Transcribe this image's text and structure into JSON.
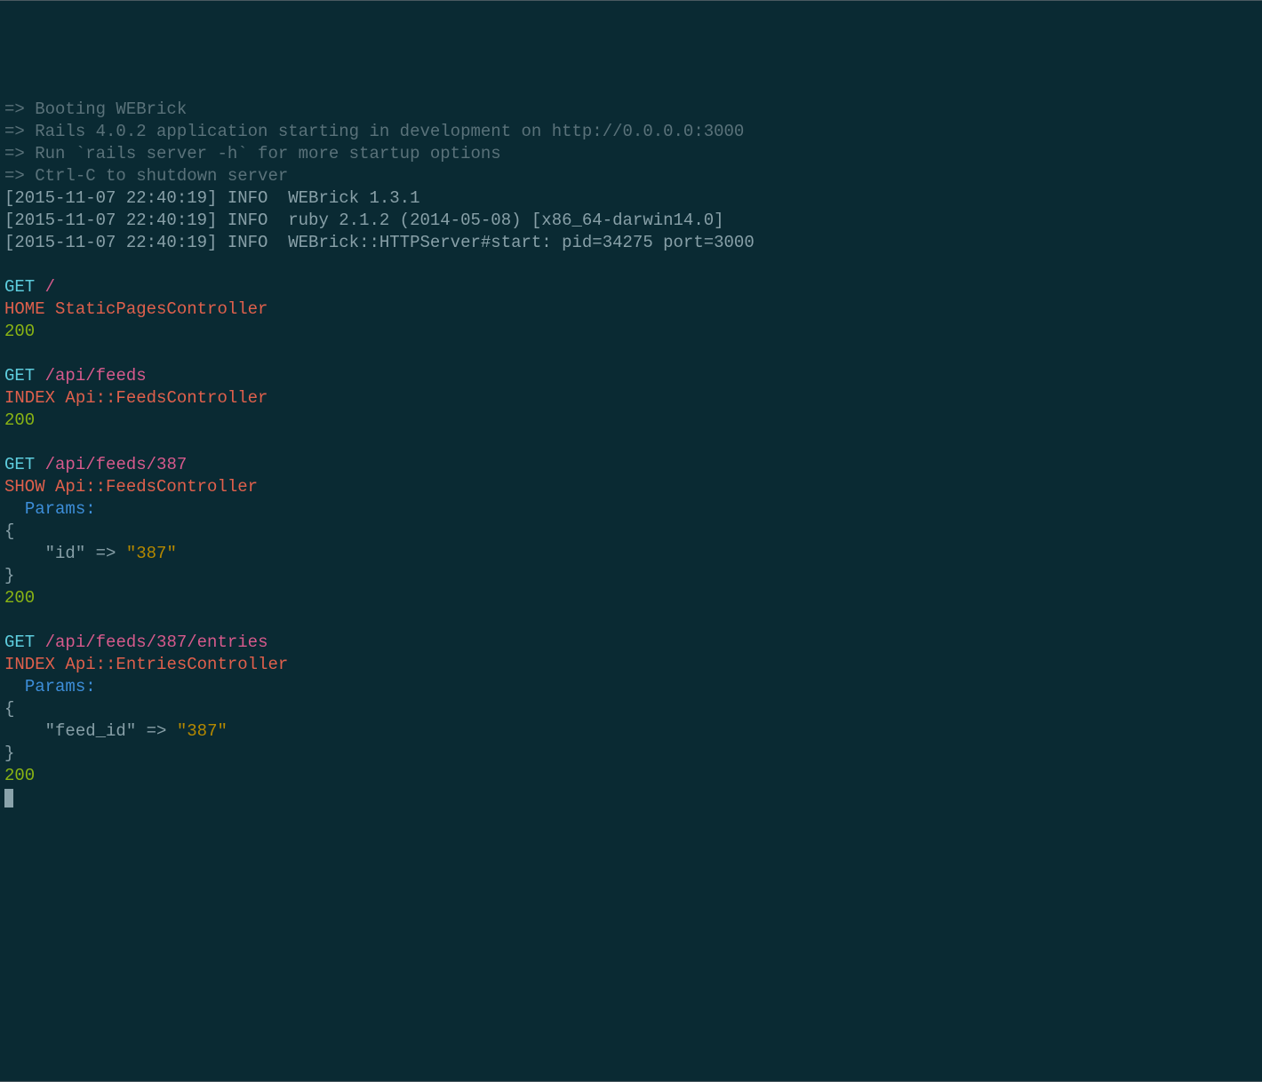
{
  "boot": {
    "l1": "=> Booting WEBrick",
    "l2": "=> Rails 4.0.2 application starting in development on http://0.0.0.0:3000",
    "l3": "=> Run `rails server -h` for more startup options",
    "l4": "=> Ctrl-C to shutdown server",
    "l5": "[2015-11-07 22:40:19] INFO  WEBrick 1.3.1",
    "l6": "[2015-11-07 22:40:19] INFO  ruby 2.1.2 (2014-05-08) [x86_64-darwin14.0]",
    "l7": "[2015-11-07 22:40:19] INFO  WEBrick::HTTPServer#start: pid=34275 port=3000"
  },
  "r1": {
    "method": "GET",
    "path": "/",
    "action": "HOME",
    "controller": "StaticPagesController",
    "status": "200"
  },
  "r2": {
    "method": "GET",
    "path": "/api/feeds",
    "action": "INDEX",
    "controller": "Api::FeedsController",
    "status": "200"
  },
  "r3": {
    "method": "GET",
    "path": "/api/feeds/387",
    "action": "SHOW",
    "controller": "Api::FeedsController",
    "params_label": "Params:",
    "open": "{",
    "key": "\"id\"",
    "arrow": "=>",
    "val": "\"387\"",
    "close": "}",
    "status": "200"
  },
  "r4": {
    "method": "GET",
    "path": "/api/feeds/387/entries",
    "action": "INDEX",
    "controller": "Api::EntriesController",
    "params_label": "Params:",
    "open": "{",
    "key": "\"feed_id\"",
    "arrow": "=>",
    "val": "\"387\"",
    "close": "}",
    "status": "200"
  }
}
